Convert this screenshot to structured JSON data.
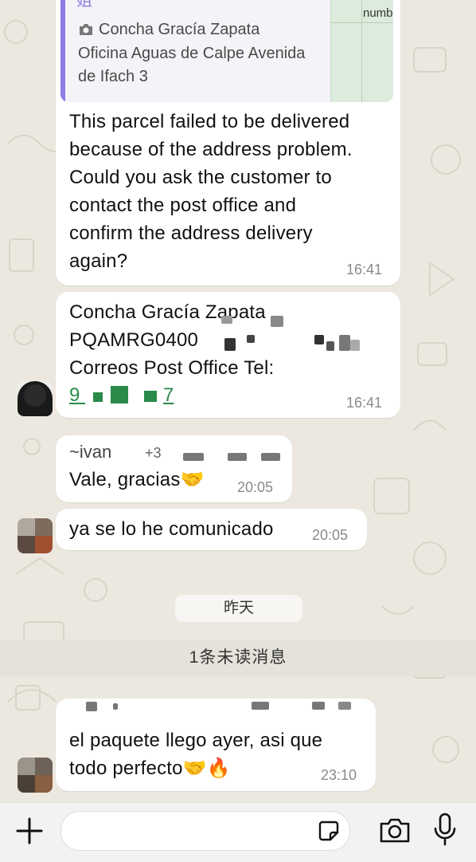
{
  "colors": {
    "chat_bg": "#ece8df",
    "bubble_bg": "#ffffff",
    "quote_bar": "#8c7ee6",
    "link_green": "#2a8a4a",
    "time_gray": "#8a8a8a",
    "input_bar": "#f2f2f2"
  },
  "quote": {
    "top_fragment": "姐",
    "sender_icon": "camera-icon",
    "line1": "Concha Gracía Zapata",
    "line2": "Oficina Aguas de Calpe Avenida",
    "line3": "de Ifach 3",
    "thumb_text": "numb"
  },
  "messages": [
    {
      "lines": [
        "This parcel failed to be delivered",
        "because of the address problem.",
        "Could you ask the customer to",
        "contact the post office and",
        "confirm the address delivery",
        "again?"
      ],
      "time": "16:41"
    },
    {
      "line1": "Concha Gracía Zapata",
      "line2": "PQAMRG0400",
      "line3": "Correos Post Office Tel:",
      "phone_start": "9",
      "phone_end": "7",
      "time": "16:41"
    },
    {
      "sender": "~ivan",
      "sender_phone_prefix": "+3",
      "text": "Vale, gracias🤝",
      "time": "20:05"
    },
    {
      "text": "ya se lo he comunicado",
      "time": "20:05"
    },
    {
      "text_line1": "el paquete llego ayer, asi que",
      "text_line2": "todo perfecto🤝🔥",
      "time": "23:10"
    }
  ],
  "date_divider": "昨天",
  "unread_banner": "1条未读消息",
  "input_bar": {
    "plus_icon": "plus-icon",
    "sticker_icon": "sticker-icon",
    "camera_icon": "camera-icon",
    "mic_icon": "microphone-icon",
    "placeholder": ""
  }
}
